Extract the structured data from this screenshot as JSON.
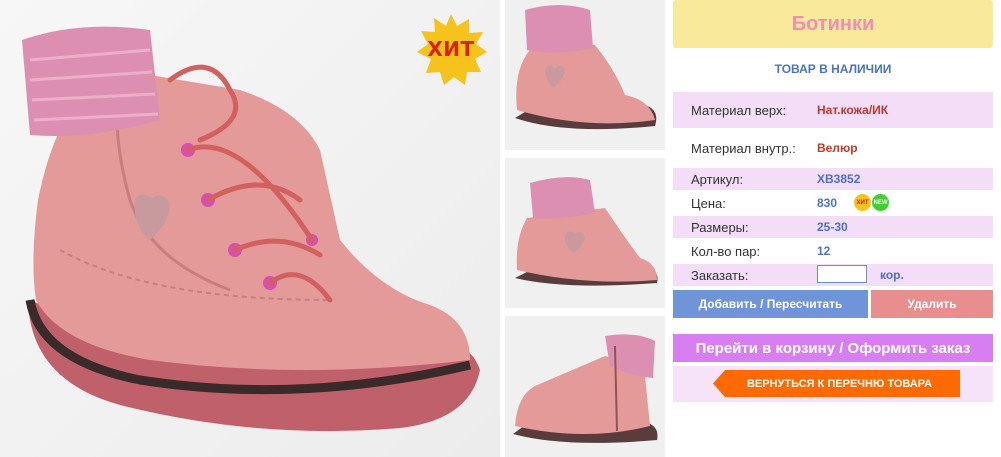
{
  "product": {
    "title": "Ботинки",
    "availability": "ТОВАР В НАЛИЧИИ",
    "hit_badge": "ХИТ"
  },
  "details": {
    "material_top_label": "Материал верх:",
    "material_top_value": "Нат.кожа/ИК",
    "material_inner_label": "Материал внутр.:",
    "material_inner_value": "Велюр",
    "article_label": "Артикул:",
    "article_value": "ХВ3852",
    "price_label": "Цена:",
    "price_value": "830",
    "price_badge_hit": "ХИТ",
    "price_badge_new": "NEW",
    "sizes_label": "Размеры:",
    "sizes_value": "25-30",
    "pairs_label": "Кол-во пар:",
    "pairs_value": "12",
    "order_label": "Заказать:",
    "order_value": "",
    "order_unit": "кор."
  },
  "actions": {
    "update": "Добавить / Пересчитать",
    "delete": "Удалить",
    "cart": "Перейти в корзину / Оформить заказ",
    "back": "ВЕРНУТЬСЯ К ПЕРЕЧНЮ ТОВАРА"
  },
  "icons": {
    "hit_badge": "starburst-badge-icon",
    "back_arrow": "arrow-left-icon"
  },
  "colors": {
    "title_bg": "#f8e99b",
    "title_text": "#f08fb0",
    "row_stripe": "#f3ddf7",
    "link_blue": "#4a72c9",
    "value_red": "#c0392b",
    "update_button": "#6f94d8",
    "delete_button": "#e88e8e",
    "cart_button": "#d77ef3",
    "back_button": "#ff6a00",
    "badge_yellow": "#f6c21c"
  }
}
